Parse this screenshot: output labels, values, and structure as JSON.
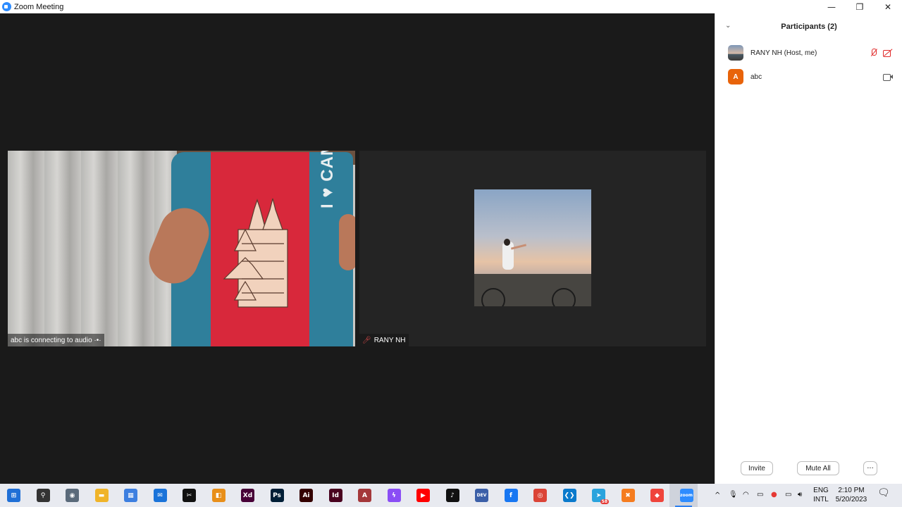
{
  "window": {
    "title": "Zoom Meeting",
    "controls": [
      "—",
      "❐",
      "✕"
    ]
  },
  "video": {
    "left_tile_label": "abc is connecting to audio ·•·",
    "right_tile_label": "RANY NH",
    "pillow_text": "I ♥ CAMBODIA"
  },
  "participants": {
    "header": "Participants (2)",
    "list": [
      {
        "name": "RANY NH (Host, me)",
        "avatar": "photo",
        "mic": "muted",
        "video": "off"
      },
      {
        "name": "abc",
        "avatar": "A",
        "avatar_color": "#e8630a",
        "video": "on"
      }
    ],
    "buttons": {
      "invite": "Invite",
      "mute_all": "Mute All",
      "more": "···"
    }
  },
  "taskbar": {
    "apps": [
      {
        "name": "start",
        "glyph": "⊞",
        "color": "#1f6fd6"
      },
      {
        "name": "search",
        "glyph": "⚲",
        "color": "#333333"
      },
      {
        "name": "camera",
        "glyph": "◉",
        "color": "#5a6a7a"
      },
      {
        "name": "file-explorer",
        "glyph": "▬",
        "color": "#f0b429"
      },
      {
        "name": "store",
        "glyph": "▦",
        "color": "#3d7fe0"
      },
      {
        "name": "mail",
        "glyph": "✉",
        "color": "#1a73d9"
      },
      {
        "name": "capcut",
        "glyph": "✂",
        "color": "#111111"
      },
      {
        "name": "files-app",
        "glyph": "◧",
        "color": "#e88f1a"
      },
      {
        "name": "adobe-xd",
        "glyph": "Xd",
        "color": "#470137"
      },
      {
        "name": "photoshop",
        "glyph": "Ps",
        "color": "#001e36"
      },
      {
        "name": "illustrator",
        "glyph": "Ai",
        "color": "#330000"
      },
      {
        "name": "indesign",
        "glyph": "Id",
        "color": "#49021f"
      },
      {
        "name": "access",
        "glyph": "A",
        "color": "#a4373a"
      },
      {
        "name": "messenger",
        "glyph": "ϟ",
        "color": "#8a4df5"
      },
      {
        "name": "youtube",
        "glyph": "▶",
        "color": "#ff0000"
      },
      {
        "name": "tiktok",
        "glyph": "♪",
        "color": "#111111"
      },
      {
        "name": "dev-cpp",
        "glyph": "DEV",
        "color": "#3b5fa8"
      },
      {
        "name": "facebook",
        "glyph": "f",
        "color": "#1877f2"
      },
      {
        "name": "chrome",
        "glyph": "◎",
        "color": "#db4437"
      },
      {
        "name": "vscode",
        "glyph": "❮❯",
        "color": "#0a7acc"
      },
      {
        "name": "telegram",
        "glyph": "➤",
        "color": "#2aa3dd",
        "badge": "58"
      },
      {
        "name": "xampp",
        "glyph": "✖",
        "color": "#f57c1f"
      },
      {
        "name": "anydesk",
        "glyph": "◆",
        "color": "#ef443b"
      },
      {
        "name": "zoom",
        "glyph": "zoom",
        "color": "#2d8cff"
      }
    ],
    "tray": {
      "chevron": "^",
      "lang_top": "ENG",
      "lang_bottom": "INTL",
      "time": "2:10 PM",
      "date": "5/20/2023"
    }
  }
}
